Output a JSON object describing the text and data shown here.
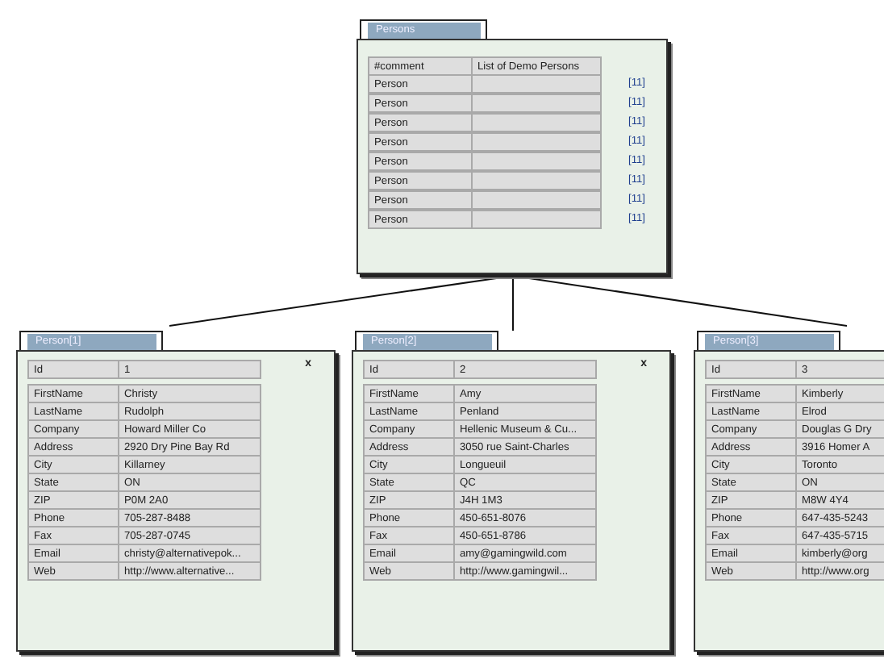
{
  "root": {
    "title": "Persons",
    "columns": [
      "#comment",
      "List of Demo Persons"
    ],
    "rows": [
      {
        "label": "Person",
        "count": "[11]"
      },
      {
        "label": "Person",
        "count": "[11]"
      },
      {
        "label": "Person",
        "count": "[11]"
      },
      {
        "label": "Person",
        "count": "[11]"
      },
      {
        "label": "Person",
        "count": "[11]"
      },
      {
        "label": "Person",
        "count": "[11]"
      },
      {
        "label": "Person",
        "count": "[11]"
      },
      {
        "label": "Person",
        "count": "[11]"
      }
    ]
  },
  "persons": [
    {
      "title": "Person[1]",
      "close": "x",
      "id_label": "Id",
      "id": "1",
      "fields": [
        {
          "label": "FirstName",
          "value": "Christy"
        },
        {
          "label": "LastName",
          "value": "Rudolph"
        },
        {
          "label": "Company",
          "value": "Howard Miller Co"
        },
        {
          "label": "Address",
          "value": "2920 Dry Pine Bay Rd"
        },
        {
          "label": "City",
          "value": "Killarney"
        },
        {
          "label": "State",
          "value": "ON"
        },
        {
          "label": "ZIP",
          "value": "P0M 2A0"
        },
        {
          "label": "Phone",
          "value": "705-287-8488"
        },
        {
          "label": "Fax",
          "value": "705-287-0745"
        },
        {
          "label": "Email",
          "value": "christy@alternativepok..."
        },
        {
          "label": "Web",
          "value": "http://www.alternative..."
        }
      ]
    },
    {
      "title": "Person[2]",
      "close": "x",
      "id_label": "Id",
      "id": "2",
      "fields": [
        {
          "label": "FirstName",
          "value": "Amy"
        },
        {
          "label": "LastName",
          "value": "Penland"
        },
        {
          "label": "Company",
          "value": "Hellenic Museum & Cu..."
        },
        {
          "label": "Address",
          "value": "3050 rue Saint-Charles"
        },
        {
          "label": "City",
          "value": "Longueuil"
        },
        {
          "label": "State",
          "value": "QC"
        },
        {
          "label": "ZIP",
          "value": "J4H 1M3"
        },
        {
          "label": "Phone",
          "value": "450-651-8076"
        },
        {
          "label": "Fax",
          "value": "450-651-8786"
        },
        {
          "label": "Email",
          "value": "amy@gamingwild.com"
        },
        {
          "label": "Web",
          "value": "http://www.gamingwil..."
        }
      ]
    },
    {
      "title": "Person[3]",
      "id_label": "Id",
      "id": "3",
      "fields": [
        {
          "label": "FirstName",
          "value": "Kimberly"
        },
        {
          "label": "LastName",
          "value": "Elrod"
        },
        {
          "label": "Company",
          "value": "Douglas G Dry"
        },
        {
          "label": "Address",
          "value": "3916 Homer A"
        },
        {
          "label": "City",
          "value": "Toronto"
        },
        {
          "label": "State",
          "value": "ON"
        },
        {
          "label": "ZIP",
          "value": "M8W 4Y4"
        },
        {
          "label": "Phone",
          "value": "647-435-5243"
        },
        {
          "label": "Fax",
          "value": "647-435-5715"
        },
        {
          "label": "Email",
          "value": "kimberly@org"
        },
        {
          "label": "Web",
          "value": "http://www.org"
        }
      ]
    }
  ]
}
